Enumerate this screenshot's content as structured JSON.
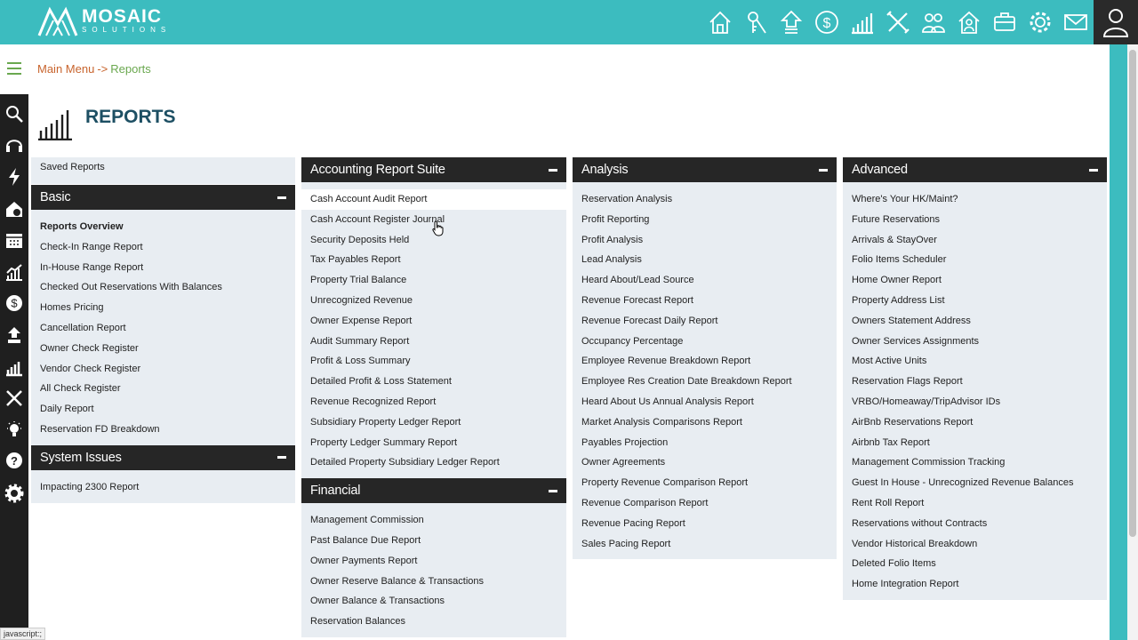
{
  "brand": {
    "name": "MOSAIC",
    "sub": "SOLUTIONS"
  },
  "top_nav": [
    {
      "name": "home-icon"
    },
    {
      "name": "keys-icon"
    },
    {
      "name": "upload-icon"
    },
    {
      "name": "dollar-icon"
    },
    {
      "name": "bar-chart-icon"
    },
    {
      "name": "tools-icon"
    },
    {
      "name": "people-icon"
    },
    {
      "name": "house-user-icon"
    },
    {
      "name": "briefcase-icon"
    },
    {
      "name": "gear-icon"
    },
    {
      "name": "mail-icon"
    }
  ],
  "breadcrumb": {
    "main": "Main Menu",
    "sep": "->",
    "current": "Reports"
  },
  "page": {
    "title": "REPORTS"
  },
  "columns": {
    "col1": {
      "saved": "Saved Reports",
      "basic": {
        "title": "Basic",
        "items": [
          "Reports Overview",
          "Check-In Range Report",
          "In-House Range Report",
          "Checked Out Reservations With Balances",
          "Homes Pricing",
          "Cancellation Report",
          "Owner Check Register",
          "Vendor Check Register",
          "All Check Register",
          "Daily Report",
          "Reservation FD Breakdown"
        ]
      },
      "system": {
        "title": "System Issues",
        "items": [
          "Impacting 2300 Report"
        ]
      }
    },
    "col2": {
      "accounting": {
        "title": "Accounting Report Suite",
        "items": [
          "Cash Account Audit Report",
          "Cash Account Register Journal",
          "Security Deposits Held",
          "Tax Payables Report",
          "Property Trial Balance",
          "Unrecognized Revenue",
          "Owner Expense Report",
          "Audit Summary Report",
          "Profit & Loss Summary",
          "Detailed Profit & Loss Statement",
          "Revenue Recognized Report",
          "Subsidiary Property Ledger Report",
          "Property Ledger Summary Report",
          "Detailed Property Subsidiary Ledger Report"
        ]
      },
      "financial": {
        "title": "Financial",
        "items": [
          "Management Commission",
          "Past Balance Due Report",
          "Owner Payments Report",
          "Owner Reserve Balance & Transactions",
          "Owner Balance & Transactions",
          "Reservation Balances"
        ]
      }
    },
    "col3": {
      "analysis": {
        "title": "Analysis",
        "items": [
          "Reservation Analysis",
          "Profit Reporting",
          "Profit Analysis",
          "Lead Analysis",
          "Heard About/Lead Source",
          "Revenue Forecast Report",
          "Revenue Forecast Daily Report",
          "Occupancy Percentage",
          "Employee Revenue Breakdown Report",
          "Employee Res Creation Date Breakdown Report",
          "Heard About Us Annual Analysis Report",
          "Market Analysis Comparisons Report",
          "Payables Projection",
          "Owner Agreements",
          "Property Revenue Comparison Report",
          "Revenue Comparison Report",
          "Revenue Pacing Report",
          "Sales Pacing Report"
        ]
      }
    },
    "col4": {
      "advanced": {
        "title": "Advanced",
        "items": [
          "Where's Your HK/Maint?",
          "Future Reservations",
          "Arrivals & StayOver",
          "Folio Items Scheduler",
          "Home Owner Report",
          "Property Address List",
          "Owners Statement Address",
          "Owner Services Assignments",
          "Most Active Units",
          "Reservation Flags Report",
          "VRBO/Homeaway/TripAdvisor IDs",
          "AirBnb Reservations Report",
          "Airbnb Tax Report",
          "Management Commission Tracking",
          "Guest In House - Unrecognized Revenue Balances",
          "Rent Roll Report",
          "Reservations without Contracts",
          "Vendor Historical Breakdown",
          "Deleted Folio Items",
          "Home Integration Report"
        ]
      }
    }
  },
  "statusbar": "javascript:;",
  "colors": {
    "teal": "#3cbcbf",
    "dark": "#262626",
    "title": "#1d4f63",
    "crumb_orange": "#c8642d",
    "crumb_green": "#6aa84f"
  }
}
